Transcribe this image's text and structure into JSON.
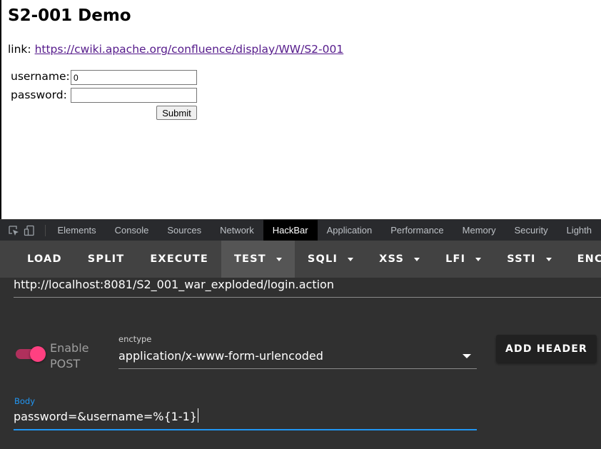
{
  "page": {
    "title": "S2-001 Demo",
    "link_prefix": "link: ",
    "link_url": "https://cwiki.apache.org/confluence/display/WW/S2-001",
    "form": {
      "username_label": "username:",
      "username_value": "0",
      "password_label": "password:",
      "password_value": "",
      "submit_label": "Submit"
    }
  },
  "devtools": {
    "tabs": [
      "Elements",
      "Console",
      "Sources",
      "Network",
      "HackBar",
      "Application",
      "Performance",
      "Memory",
      "Security",
      "Lighth"
    ],
    "active_tab": "HackBar"
  },
  "hackbar": {
    "menu": [
      {
        "label": "LOAD",
        "dropdown": false
      },
      {
        "label": "SPLIT",
        "dropdown": false
      },
      {
        "label": "EXECUTE",
        "dropdown": false
      },
      {
        "label": "TEST",
        "dropdown": true
      },
      {
        "label": "SQLI",
        "dropdown": true
      },
      {
        "label": "XSS",
        "dropdown": true
      },
      {
        "label": "LFI",
        "dropdown": true
      },
      {
        "label": "SSTI",
        "dropdown": true
      },
      {
        "label": "ENCO",
        "dropdown": false
      }
    ],
    "active_menu": "TEST",
    "url": "http://localhost:8081/S2_001_war_exploded/login.action",
    "enable_post_label_line1": "Enable",
    "enable_post_label_line2": "POST",
    "enable_post": true,
    "enctype_label": "enctype",
    "enctype_value": "application/x-www-form-urlencoded",
    "add_header_label": "ADD HEADER",
    "body_label": "Body",
    "body_value": "password=&username=%{1-1}"
  },
  "colors": {
    "accent_pink": "#ff4081",
    "focus_blue": "#2196f3",
    "panel_bg": "#303030",
    "menu_bg": "#424242"
  }
}
